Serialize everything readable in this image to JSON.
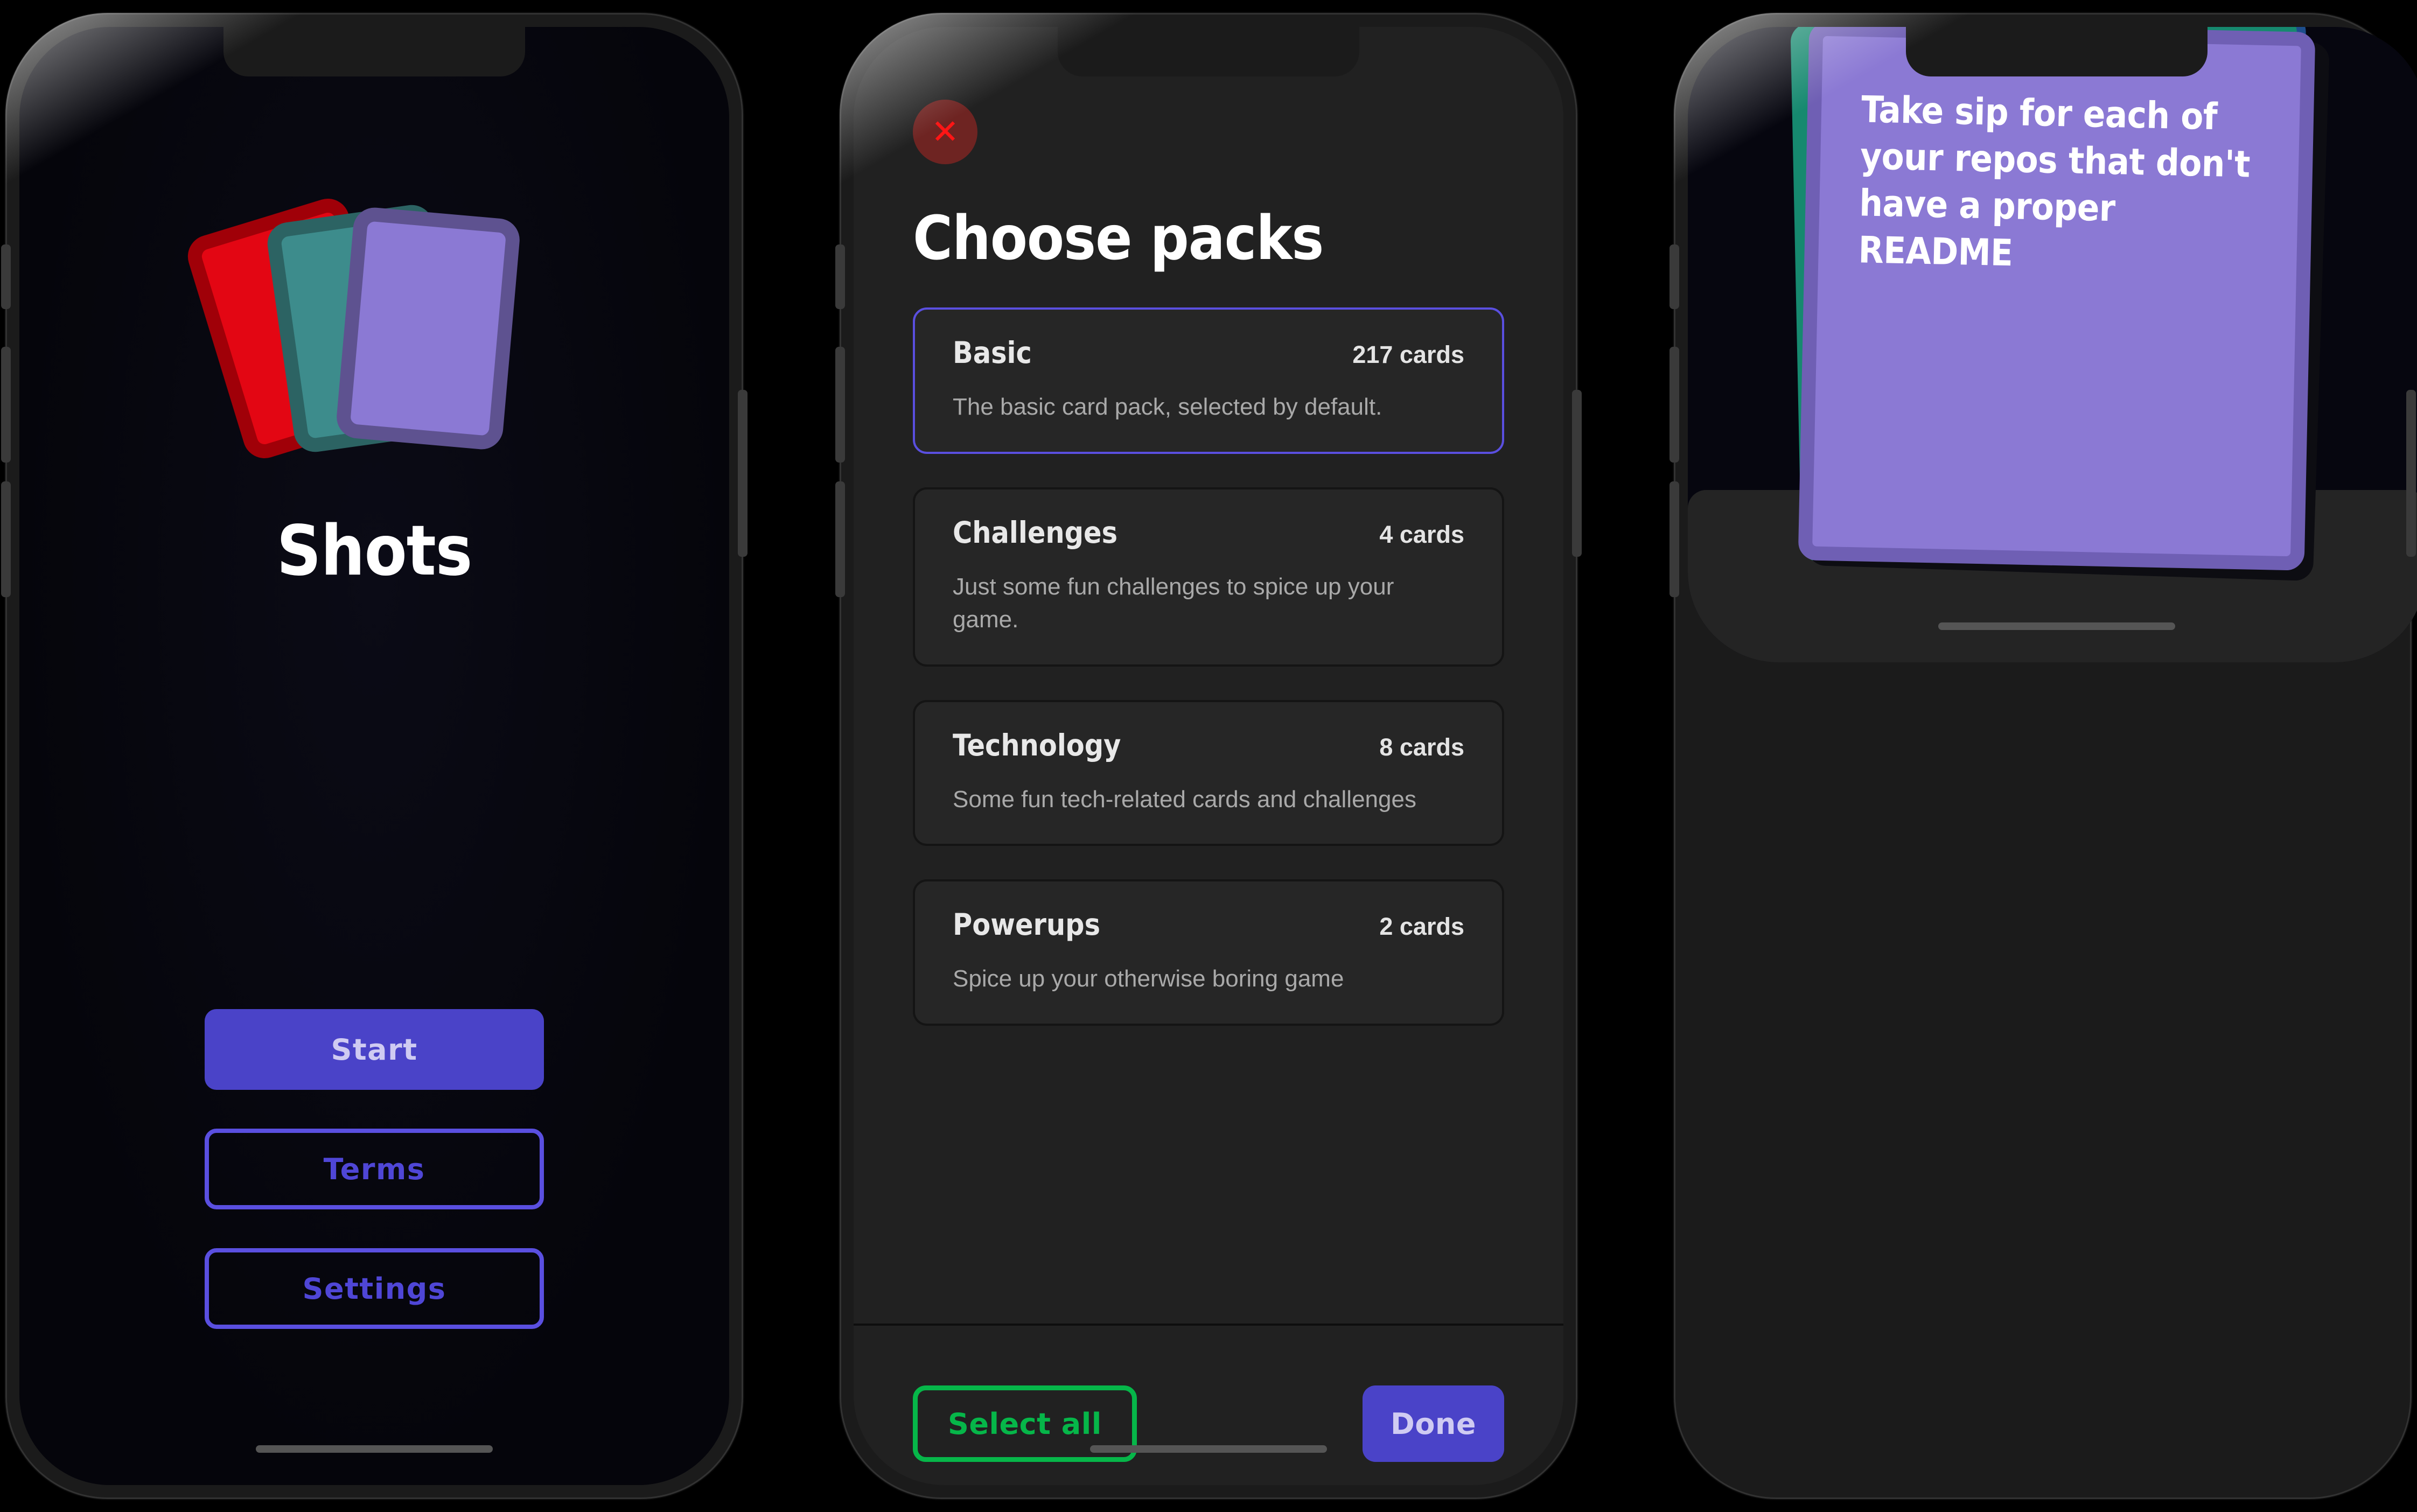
{
  "app": {
    "name": "Shots"
  },
  "screens": {
    "home": {
      "title": "Shots",
      "logo_cards": [
        {
          "name": "red-card",
          "fill": "#E30613",
          "border": "#A00008"
        },
        {
          "name": "teal-card",
          "fill": "#3D8C8C",
          "border": "#2C6363"
        },
        {
          "name": "purple-card",
          "fill": "#8B79D4",
          "border": "#5E5290"
        }
      ],
      "buttons": [
        {
          "label": "Start",
          "style": "primary"
        },
        {
          "label": "Terms",
          "style": "outline"
        },
        {
          "label": "Settings",
          "style": "outline"
        }
      ]
    },
    "choose_packs": {
      "close_icon": "close-icon",
      "close_glyph": "✕",
      "title": "Choose packs",
      "packs": [
        {
          "name": "Basic",
          "count": "217 cards",
          "description": "The basic card pack, selected by default.",
          "selected": true
        },
        {
          "name": "Challenges",
          "count": "4 cards",
          "description": "Just some fun challenges to spice up your game.",
          "selected": false
        },
        {
          "name": "Technology",
          "count": "8 cards",
          "description": "Some fun tech-related cards and challenges",
          "selected": false
        },
        {
          "name": "Powerups",
          "count": "2 cards",
          "description": "Spice up your otherwise boring game",
          "selected": false
        }
      ],
      "footer": {
        "select_all_label": "Select all",
        "done_label": "Done"
      }
    },
    "game": {
      "card_text": "Take sip for each of your repos that don't have a proper README"
    }
  },
  "colors": {
    "accent_purple": "#4A43C8",
    "accent_purple_light": "#8B79D4",
    "accent_green": "#06B649",
    "accent_red": "#FF1515",
    "close_bg": "#6E2422",
    "card_bg": "#262626",
    "screen_dark": "#06060c",
    "screen_gray": "#212121"
  }
}
